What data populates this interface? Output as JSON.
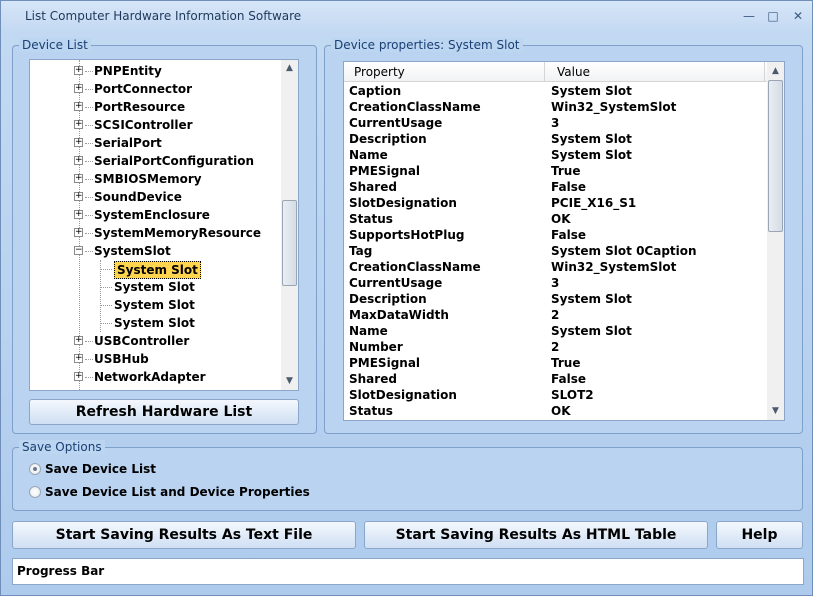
{
  "window": {
    "title": "List Computer Hardware Information Software",
    "min": "—",
    "max": "□",
    "close": "✕"
  },
  "device_list": {
    "label": "Device List",
    "items": [
      {
        "label": "PNPEntity",
        "expanded": false
      },
      {
        "label": "PortConnector",
        "expanded": false
      },
      {
        "label": "PortResource",
        "expanded": false
      },
      {
        "label": "SCSIController",
        "expanded": false
      },
      {
        "label": "SerialPort",
        "expanded": false
      },
      {
        "label": "SerialPortConfiguration",
        "expanded": false
      },
      {
        "label": "SMBIOSMemory",
        "expanded": false
      },
      {
        "label": "SoundDevice",
        "expanded": false
      },
      {
        "label": "SystemEnclosure",
        "expanded": false
      },
      {
        "label": "SystemMemoryResource",
        "expanded": false
      },
      {
        "label": "SystemSlot",
        "expanded": true
      },
      {
        "label": "System Slot",
        "child": true,
        "selected": true
      },
      {
        "label": "System Slot",
        "child": true
      },
      {
        "label": "System Slot",
        "child": true
      },
      {
        "label": "System Slot",
        "child": true
      },
      {
        "label": "USBController",
        "expanded": false
      },
      {
        "label": "USBHub",
        "expanded": false
      },
      {
        "label": "NetworkAdapter",
        "expanded": false
      }
    ],
    "refresh_label": "Refresh Hardware List"
  },
  "device_properties": {
    "label": "Device properties: System Slot",
    "col_property": "Property",
    "col_value": "Value",
    "rows": [
      [
        "Caption",
        "System Slot"
      ],
      [
        "CreationClassName",
        "Win32_SystemSlot"
      ],
      [
        "CurrentUsage",
        "3"
      ],
      [
        "Description",
        "System Slot"
      ],
      [
        "Name",
        "System Slot"
      ],
      [
        "PMESignal",
        "True"
      ],
      [
        "Shared",
        "False"
      ],
      [
        "SlotDesignation",
        "PCIE_X16_S1"
      ],
      [
        "Status",
        "OK"
      ],
      [
        "SupportsHotPlug",
        "False"
      ],
      [
        "Tag",
        "System Slot 0Caption"
      ],
      [
        "CreationClassName",
        "Win32_SystemSlot"
      ],
      [
        "CurrentUsage",
        "3"
      ],
      [
        "Description",
        "System Slot"
      ],
      [
        "MaxDataWidth",
        "2"
      ],
      [
        "Name",
        "System Slot"
      ],
      [
        "Number",
        "2"
      ],
      [
        "PMESignal",
        "True"
      ],
      [
        "Shared",
        "False"
      ],
      [
        "SlotDesignation",
        "SLOT2"
      ],
      [
        "Status",
        "OK"
      ]
    ]
  },
  "save_options": {
    "label": "Save Options",
    "option1": "Save Device List",
    "option2": "Save Device List and Device Properties",
    "selected": 1
  },
  "buttons": {
    "save_text": "Start Saving Results As Text File",
    "save_html": "Start Saving Results As HTML Table",
    "help": "Help"
  },
  "progress": {
    "label": "Progress Bar"
  }
}
